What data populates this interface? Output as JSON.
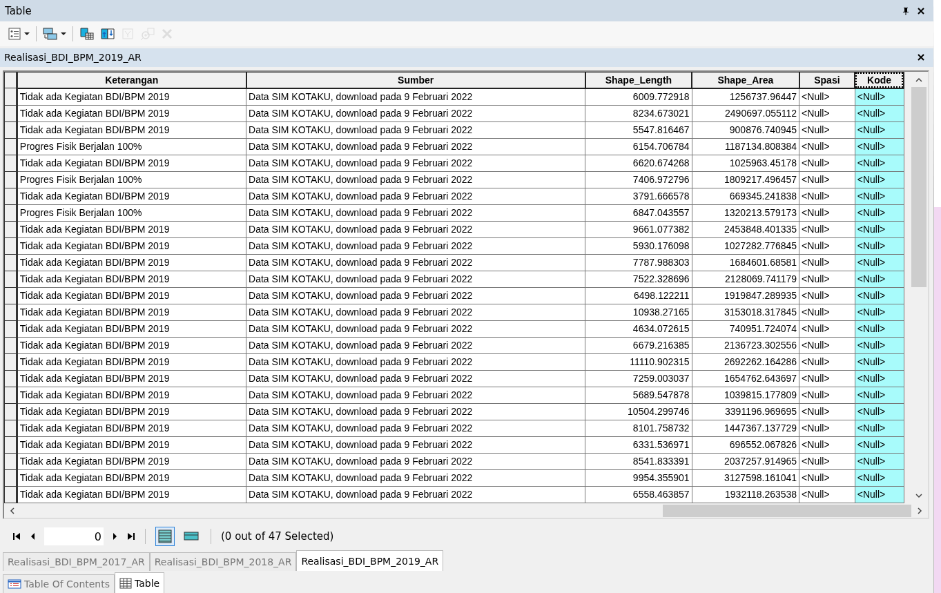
{
  "window": {
    "title": "Table"
  },
  "toolbar": [
    {
      "kind": "table-options",
      "dropdown": true,
      "disabled": false
    },
    {
      "kind": "related-tables",
      "dropdown": true,
      "disabled": false
    },
    {
      "kind": "select-by-attributes",
      "dropdown": false,
      "disabled": false
    },
    {
      "kind": "switch-selection",
      "dropdown": false,
      "disabled": false
    },
    {
      "kind": "clear-selection",
      "dropdown": false,
      "disabled": true
    },
    {
      "kind": "zoom-to-selected",
      "dropdown": false,
      "disabled": true
    },
    {
      "kind": "delete",
      "dropdown": false,
      "disabled": true
    }
  ],
  "table_title": "Realisasi_BDI_BPM_2019_AR",
  "table": {
    "columns": [
      {
        "label": "Keterangan",
        "selected": false
      },
      {
        "label": "Sumber",
        "selected": false
      },
      {
        "label": "Shape_Length",
        "selected": false
      },
      {
        "label": "Shape_Area",
        "selected": false
      },
      {
        "label": "Spasi",
        "selected": false
      },
      {
        "label": "Kode",
        "selected": true
      }
    ],
    "rows": [
      [
        "Tidak ada Kegiatan BDI/BPM 2019",
        "Data SIM KOTAKU, download pada 9 Februari 2022",
        "6009.772918",
        "1256737.96447",
        "<Null>",
        "<Null>"
      ],
      [
        "Tidak ada Kegiatan BDI/BPM 2019",
        "Data SIM KOTAKU, download pada 9 Februari 2022",
        "8234.673021",
        "2490697.055112",
        "<Null>",
        "<Null>"
      ],
      [
        "Tidak ada Kegiatan BDI/BPM 2019",
        "Data SIM KOTAKU, download pada 9 Februari 2022",
        "5547.816467",
        "900876.740945",
        "<Null>",
        "<Null>"
      ],
      [
        "Progres Fisik Berjalan 100%",
        "Data SIM KOTAKU, download pada 9 Februari 2022",
        "6154.706784",
        "1187134.808384",
        "<Null>",
        "<Null>"
      ],
      [
        "Tidak ada Kegiatan BDI/BPM 2019",
        "Data SIM KOTAKU, download pada 9 Februari 2022",
        "6620.674268",
        "1025963.45178",
        "<Null>",
        "<Null>"
      ],
      [
        "Progres Fisik Berjalan 100%",
        "Data SIM KOTAKU, download pada 9 Februari 2022",
        "7406.972796",
        "1809217.496457",
        "<Null>",
        "<Null>"
      ],
      [
        "Tidak ada Kegiatan BDI/BPM 2019",
        "Data SIM KOTAKU, download pada 9 Februari 2022",
        "3791.666578",
        "669345.241838",
        "<Null>",
        "<Null>"
      ],
      [
        "Progres Fisik Berjalan 100%",
        "Data SIM KOTAKU, download pada 9 Februari 2022",
        "6847.043557",
        "1320213.579173",
        "<Null>",
        "<Null>"
      ],
      [
        "Tidak ada Kegiatan BDI/BPM 2019",
        "Data SIM KOTAKU, download pada 9 Februari 2022",
        "9661.077382",
        "2453848.401335",
        "<Null>",
        "<Null>"
      ],
      [
        "Tidak ada Kegiatan BDI/BPM 2019",
        "Data SIM KOTAKU, download pada 9 Februari 2022",
        "5930.176098",
        "1027282.776845",
        "<Null>",
        "<Null>"
      ],
      [
        "Tidak ada Kegiatan BDI/BPM 2019",
        "Data SIM KOTAKU, download pada 9 Februari 2022",
        "7787.988303",
        "1684601.68581",
        "<Null>",
        "<Null>"
      ],
      [
        "Tidak ada Kegiatan BDI/BPM 2019",
        "Data SIM KOTAKU, download pada 9 Februari 2022",
        "7522.328696",
        "2128069.741179",
        "<Null>",
        "<Null>"
      ],
      [
        "Tidak ada Kegiatan BDI/BPM 2019",
        "Data SIM KOTAKU, download pada 9 Februari 2022",
        "6498.122211",
        "1919847.289935",
        "<Null>",
        "<Null>"
      ],
      [
        "Tidak ada Kegiatan BDI/BPM 2019",
        "Data SIM KOTAKU, download pada 9 Februari 2022",
        "10938.27165",
        "3153018.317845",
        "<Null>",
        "<Null>"
      ],
      [
        "Tidak ada Kegiatan BDI/BPM 2019",
        "Data SIM KOTAKU, download pada 9 Februari 2022",
        "4634.072615",
        "740951.724074",
        "<Null>",
        "<Null>"
      ],
      [
        "Tidak ada Kegiatan BDI/BPM 2019",
        "Data SIM KOTAKU, download pada 9 Februari 2022",
        "6679.216385",
        "2136723.302556",
        "<Null>",
        "<Null>"
      ],
      [
        "Tidak ada Kegiatan BDI/BPM 2019",
        "Data SIM KOTAKU, download pada 9 Februari 2022",
        "11110.902315",
        "2692262.164286",
        "<Null>",
        "<Null>"
      ],
      [
        "Tidak ada Kegiatan BDI/BPM 2019",
        "Data SIM KOTAKU, download pada 9 Februari 2022",
        "7259.003037",
        "1654762.643697",
        "<Null>",
        "<Null>"
      ],
      [
        "Tidak ada Kegiatan BDI/BPM 2019",
        "Data SIM KOTAKU, download pada 9 Februari 2022",
        "5689.547878",
        "1039815.177809",
        "<Null>",
        "<Null>"
      ],
      [
        "Tidak ada Kegiatan BDI/BPM 2019",
        "Data SIM KOTAKU, download pada 9 Februari 2022",
        "10504.299746",
        "3391196.969695",
        "<Null>",
        "<Null>"
      ],
      [
        "Tidak ada Kegiatan BDI/BPM 2019",
        "Data SIM KOTAKU, download pada 9 Februari 2022",
        "8101.758732",
        "1447367.137729",
        "<Null>",
        "<Null>"
      ],
      [
        "Tidak ada Kegiatan BDI/BPM 2019",
        "Data SIM KOTAKU, download pada 9 Februari 2022",
        "6331.536971",
        "696552.067826",
        "<Null>",
        "<Null>"
      ],
      [
        "Tidak ada Kegiatan BDI/BPM 2019",
        "Data SIM KOTAKU, download pada 9 Februari 2022",
        "8541.833391",
        "2037257.914965",
        "<Null>",
        "<Null>"
      ],
      [
        "Tidak ada Kegiatan BDI/BPM 2019",
        "Data SIM KOTAKU, download pada 9 Februari 2022",
        "9954.355901",
        "3127598.161041",
        "<Null>",
        "<Null>"
      ],
      [
        "Tidak ada Kegiatan BDI/BPM 2019",
        "Data SIM KOTAKU, download pada 9 Februari 2022",
        "6558.463857",
        "1932118.263538",
        "<Null>",
        "<Null>"
      ]
    ]
  },
  "navigator": {
    "record": "0",
    "views": [
      {
        "kind": "all-records",
        "selected": true
      },
      {
        "kind": "selected-records",
        "selected": false
      }
    ],
    "status": "(0 out of 47 Selected)"
  },
  "table_tabs": [
    {
      "label": "Realisasi_BDI_BPM_2017_AR",
      "selected": false
    },
    {
      "label": "Realisasi_BDI_BPM_2018_AR",
      "selected": false
    },
    {
      "label": "Realisasi_BDI_BPM_2019_AR",
      "selected": true
    }
  ],
  "dock_tabs": [
    {
      "kind": "toc",
      "label": "Table Of Contents",
      "selected": false
    },
    {
      "kind": "table",
      "label": "Table",
      "selected": true
    }
  ]
}
